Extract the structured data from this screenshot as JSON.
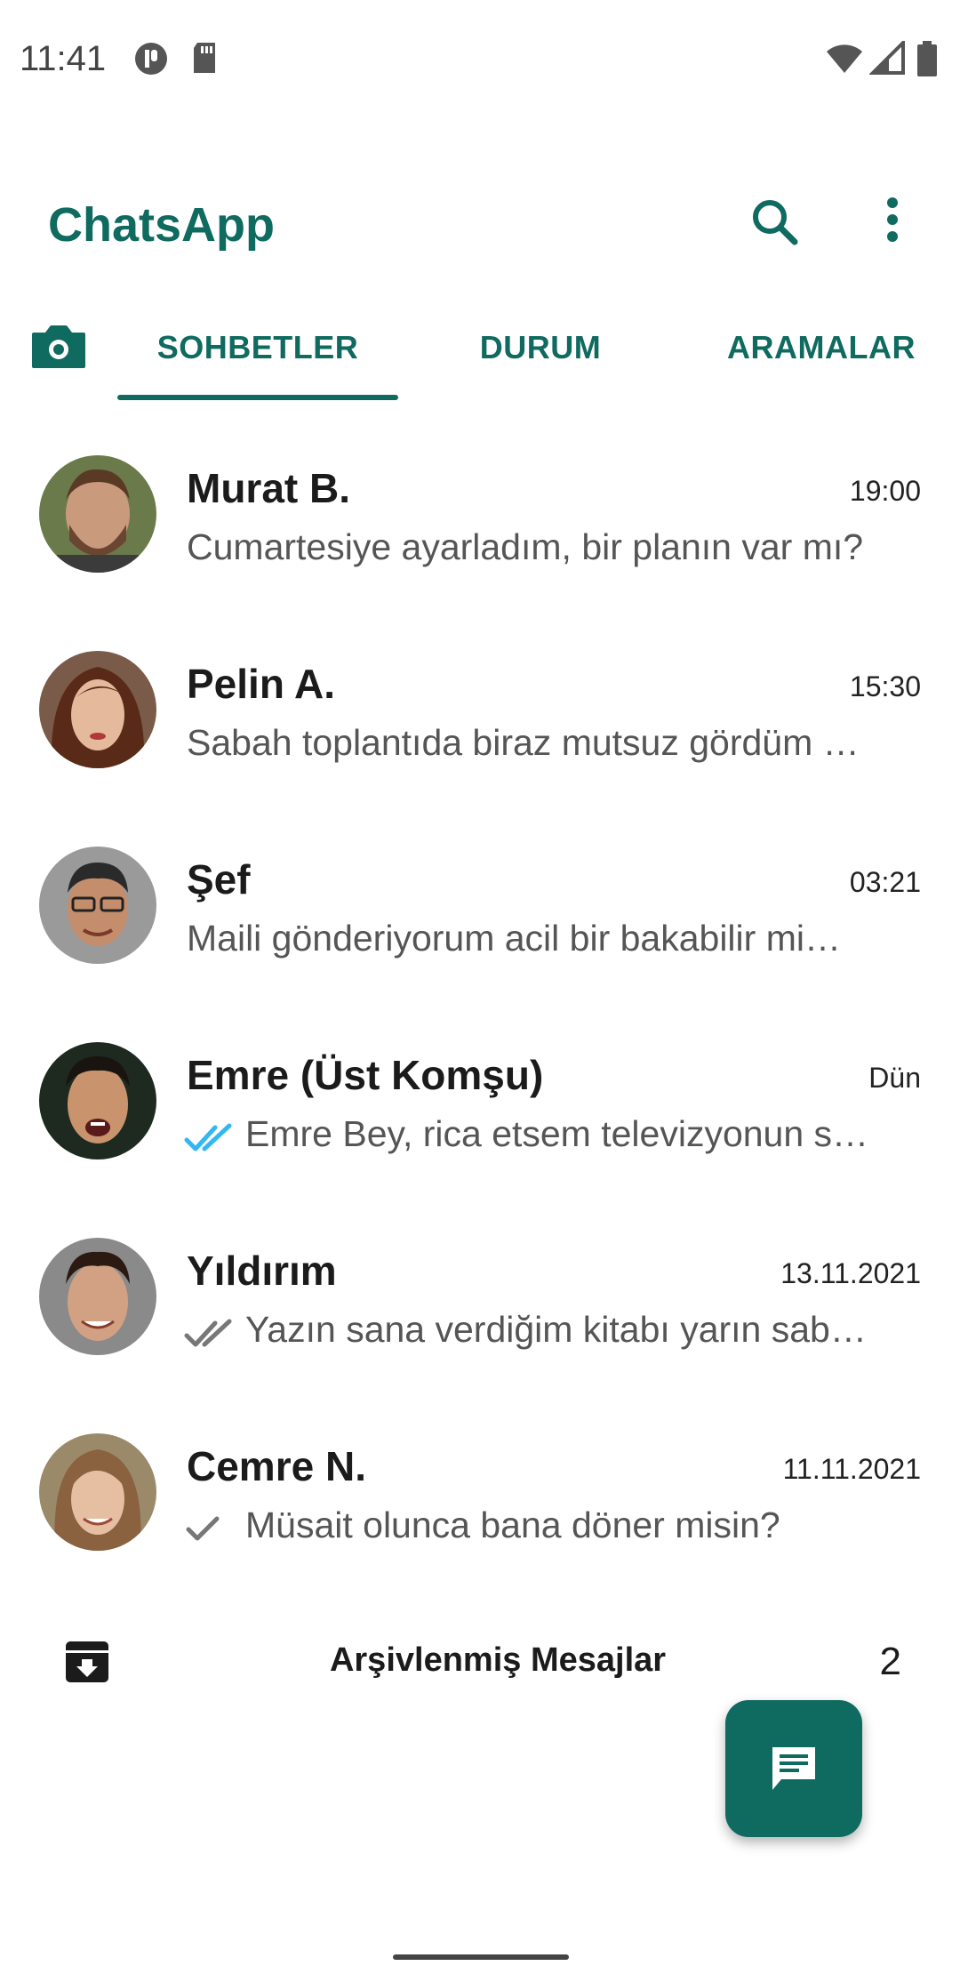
{
  "status_bar": {
    "time": "11:41"
  },
  "app_bar": {
    "title": "ChatsApp",
    "search_icon": "search-icon",
    "menu_icon": "more-vert-icon"
  },
  "tabs": [
    {
      "label": "SOHBETLER",
      "selected": true
    },
    {
      "label": "DURUM",
      "selected": false
    },
    {
      "label": "ARAMALAR",
      "selected": false
    }
  ],
  "chats": [
    {
      "name": "Murat B.",
      "time": "19:00",
      "message": "Cumartesiye ayarladım, bir planın var mı?",
      "tick": "none"
    },
    {
      "name": "Pelin A.",
      "time": "15:30",
      "message": "Sabah toplantıda biraz mutsuz gördüm …",
      "tick": "none"
    },
    {
      "name": "Şef",
      "time": "03:21",
      "message": "Maili gönderiyorum acil bir bakabilir mi…",
      "tick": "none"
    },
    {
      "name": "Emre (Üst Komşu)",
      "time": "Dün",
      "message": "Emre Bey, rica etsem televizyonun s…",
      "tick": "double-read"
    },
    {
      "name": "Yıldırım",
      "time": "13.11.2021",
      "message": "Yazın sana verdiğim kitabı yarın sab…",
      "tick": "double"
    },
    {
      "name": "Cemre N.",
      "time": "11.11.2021",
      "message": "Müsait olunca bana döner misin?",
      "tick": "single"
    }
  ],
  "archived": {
    "label": "Arşivlenmiş Mesajlar",
    "count": "2"
  },
  "colors": {
    "brand": "#0f6a5f",
    "read_tick": "#34b7f1",
    "tick": "#777777"
  }
}
